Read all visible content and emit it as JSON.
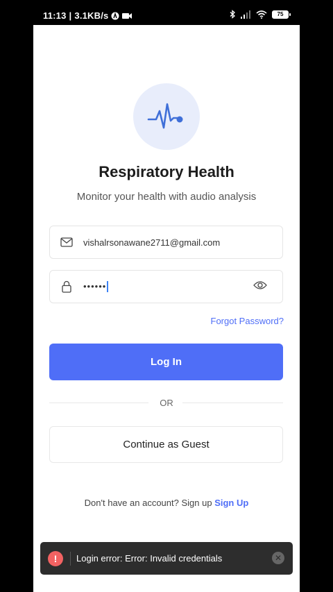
{
  "status_bar": {
    "time": "11:13",
    "network_speed": "3.1KB/s",
    "battery": "75",
    "icons": [
      "app-icon",
      "video-icon",
      "bluetooth-icon",
      "signal-icon",
      "wifi-icon",
      "battery-icon"
    ]
  },
  "app": {
    "logo_icon": "heartbeat-icon",
    "title": "Respiratory Health",
    "subtitle": "Monitor your health with audio analysis",
    "email": {
      "icon": "mail-icon",
      "value": "vishalrsonawane2711@gmail.com"
    },
    "password": {
      "icon": "lock-icon",
      "value": "••••••",
      "toggle_icon": "eye-icon"
    },
    "forgot_password": "Forgot Password?",
    "login_button": "Log In",
    "divider_text": "OR",
    "guest_button": "Continue as Guest",
    "signup_prompt": "Don't have an account? Sign up",
    "signup_link": "Sign Up",
    "accent_color": "#4f6ef7"
  },
  "toast": {
    "icon": "error-icon",
    "message": "Login error: Error: Invalid credentials",
    "close_icon": "close-icon",
    "color": "#f26262"
  }
}
